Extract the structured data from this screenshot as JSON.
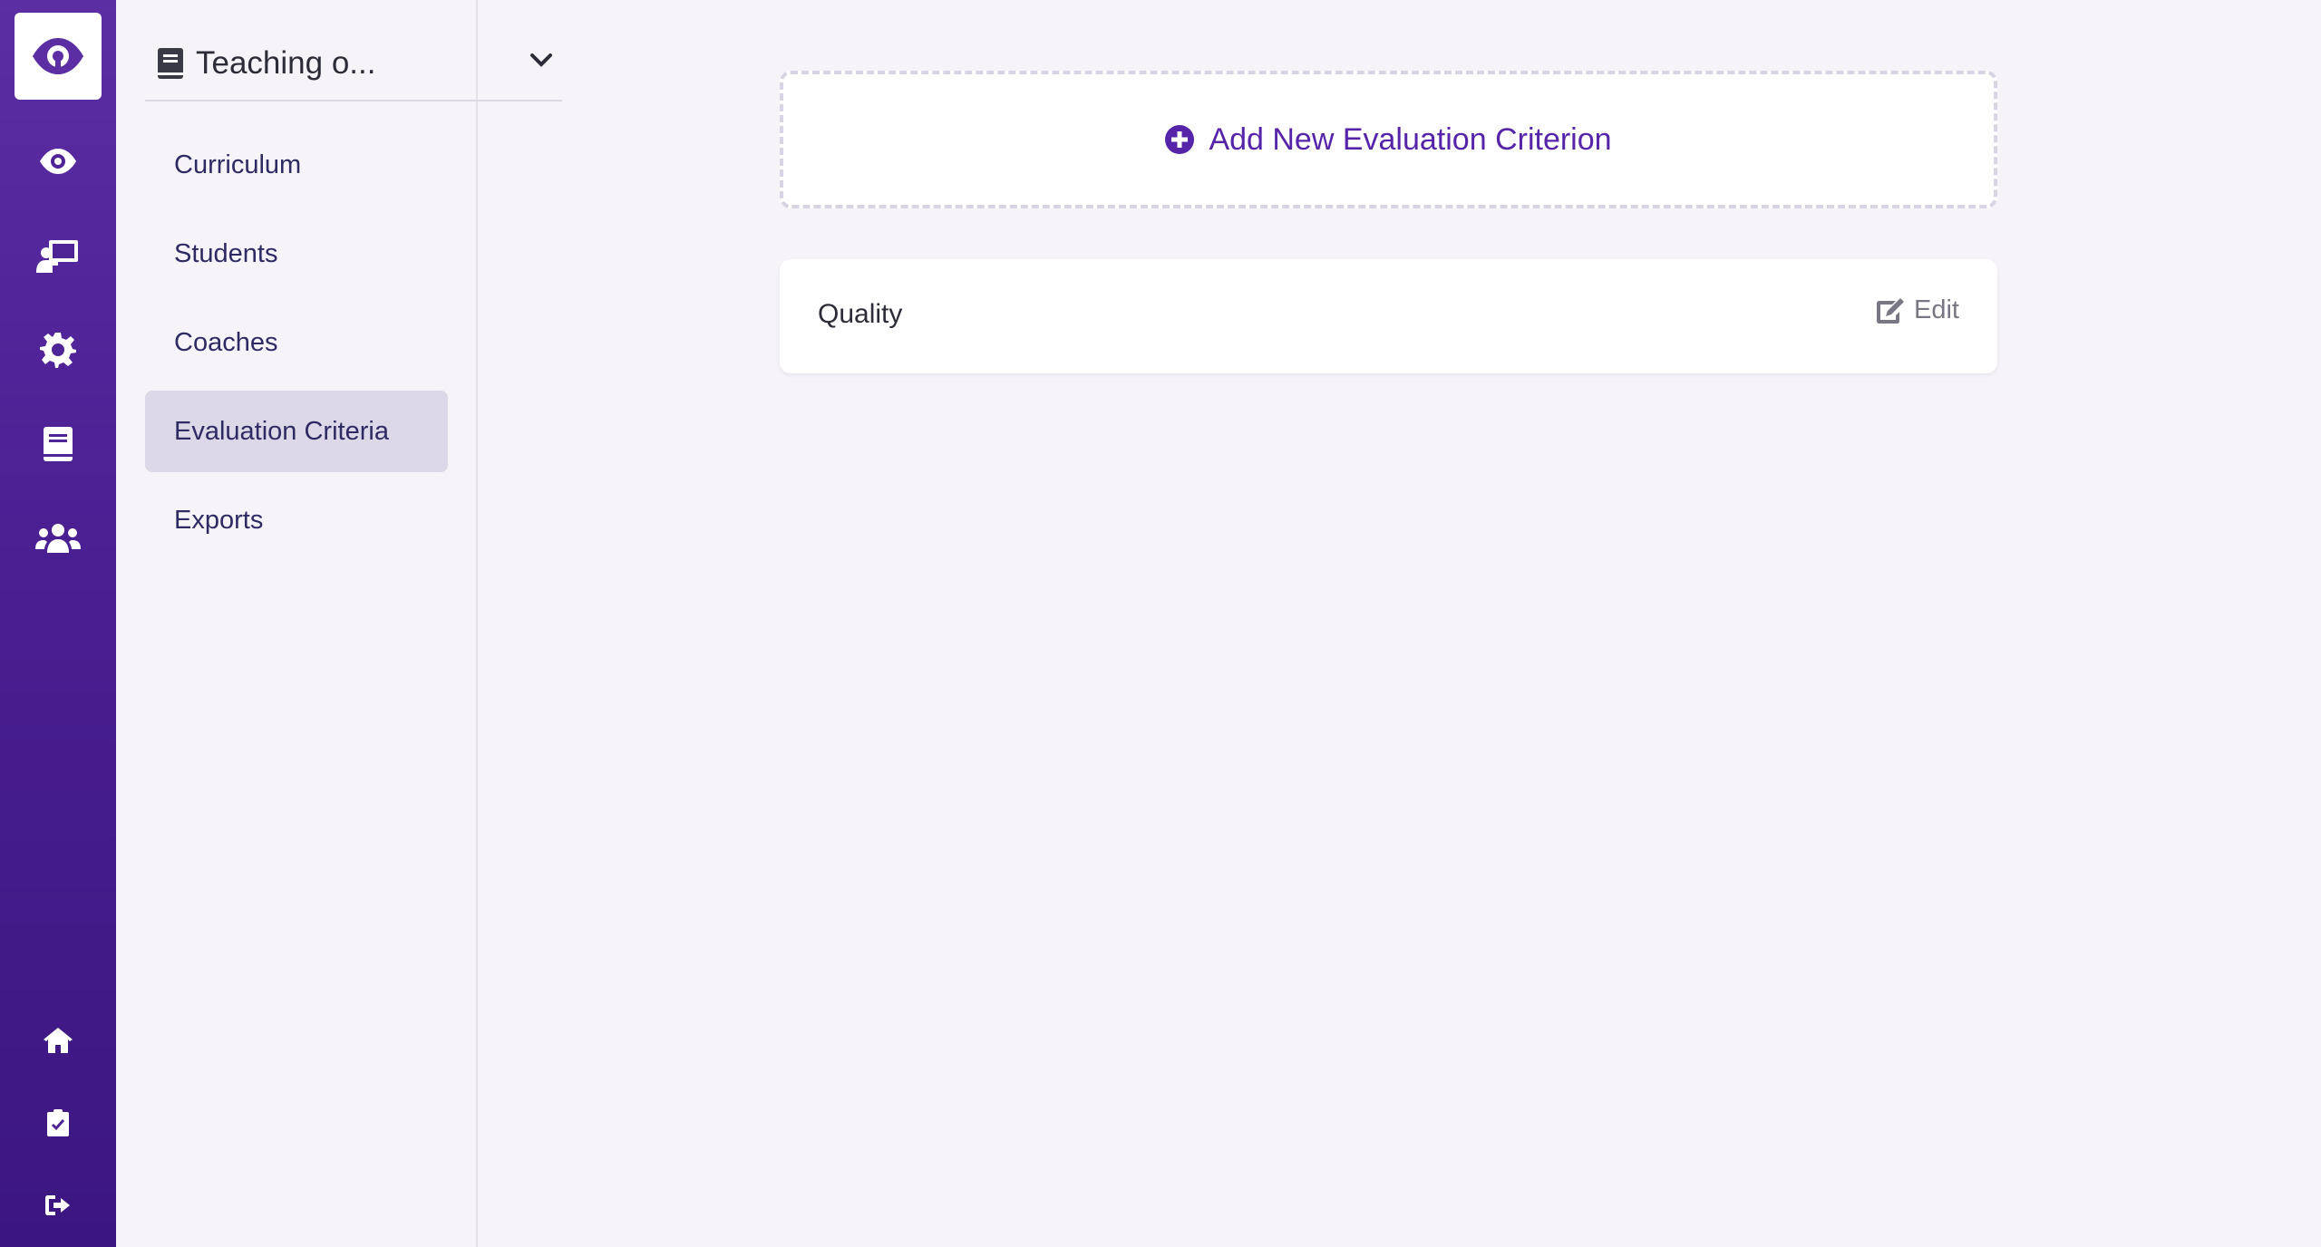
{
  "rail": {
    "logo": "eye-logo",
    "items": [
      {
        "icon": "eye-icon"
      },
      {
        "icon": "presentation-icon"
      },
      {
        "icon": "gear-icon"
      },
      {
        "icon": "book-icon"
      },
      {
        "icon": "users-icon"
      }
    ],
    "bottom_items": [
      {
        "icon": "home-icon"
      },
      {
        "icon": "clipboard-check-icon"
      },
      {
        "icon": "sign-out-icon"
      }
    ]
  },
  "course_selector": {
    "title": "Teaching o...",
    "icon": "book-icon"
  },
  "subnav": {
    "items": [
      {
        "label": "Curriculum"
      },
      {
        "label": "Students"
      },
      {
        "label": "Coaches"
      },
      {
        "label": "Evaluation Criteria",
        "active": true
      },
      {
        "label": "Exports"
      }
    ]
  },
  "main": {
    "add_button_label": "Add New Evaluation Criterion",
    "criteria": [
      {
        "name": "Quality",
        "edit_label": "Edit"
      }
    ]
  },
  "colors": {
    "accent": "#5624a8",
    "rail": "#4a1f92",
    "background": "#f6f4f9"
  }
}
